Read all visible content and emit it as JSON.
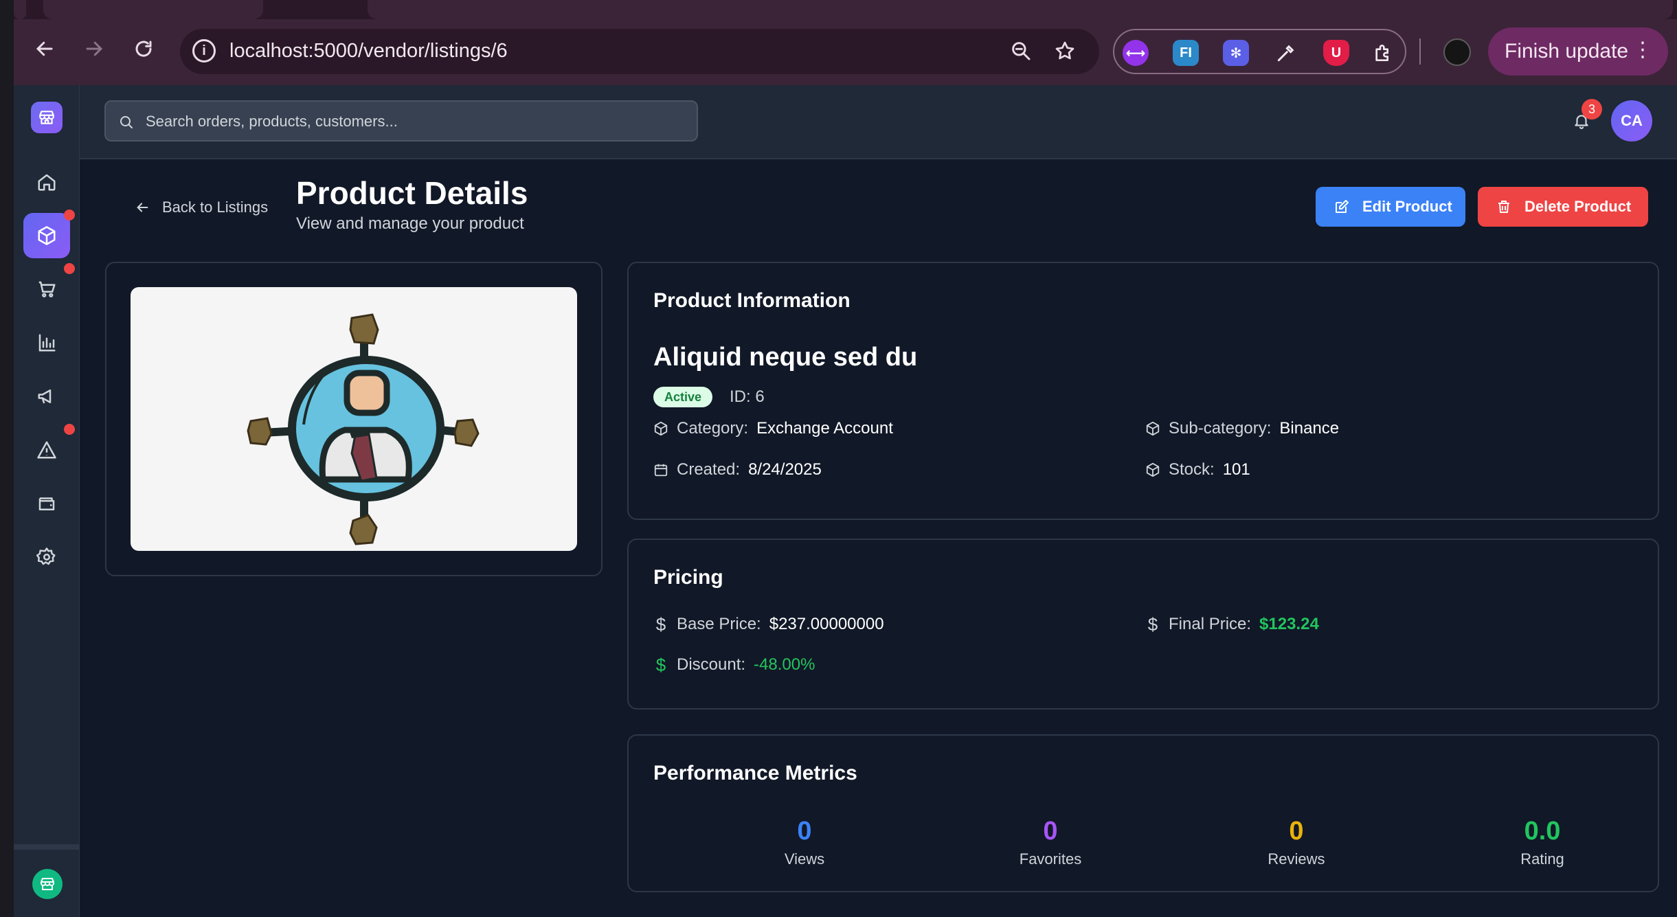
{
  "browser": {
    "url": "localhost:5000/vendor/listings/6",
    "finish_update_label": "Finish update",
    "extensions": [
      "proxy-extension-icon",
      "fi-extension-icon",
      "snowflake-extension-icon",
      "eyedropper-extension-icon",
      "ublock-extension-icon",
      "puzzle-extensions-icon"
    ]
  },
  "topbar": {
    "search_placeholder": "Search orders, products, customers...",
    "notification_count": "3",
    "avatar_initials": "CA"
  },
  "header": {
    "back_label": "Back to Listings",
    "title": "Product Details",
    "subtitle": "View and manage your product",
    "edit_label": "Edit Product",
    "delete_label": "Delete Product"
  },
  "product_info": {
    "heading": "Product Information",
    "name": "Aliquid neque sed du",
    "status": "Active",
    "id_text": "ID: 6",
    "category_label": "Category:",
    "category_value": "Exchange Account",
    "subcategory_label": "Sub-category:",
    "subcategory_value": "Binance",
    "created_label": "Created:",
    "created_value": "8/24/2025",
    "stock_label": "Stock:",
    "stock_value": "101"
  },
  "pricing": {
    "heading": "Pricing",
    "base_label": "Base Price:",
    "base_value": "$237.00000000",
    "final_label": "Final Price:",
    "final_value": "$123.24",
    "discount_label": "Discount:",
    "discount_value": "-48.00%"
  },
  "metrics": {
    "heading": "Performance Metrics",
    "items": [
      {
        "value": "0",
        "label": "Views",
        "color": "#3b82f6"
      },
      {
        "value": "0",
        "label": "Favorites",
        "color": "#a855f7"
      },
      {
        "value": "0",
        "label": "Reviews",
        "color": "#eab308"
      },
      {
        "value": "0.0",
        "label": "Rating",
        "color": "#22c55e"
      }
    ]
  },
  "colors": {
    "accent_blue": "#3b82f6",
    "danger_red": "#ef4444",
    "success_green": "#22c55e",
    "sidebar_active": "#6366f1"
  }
}
